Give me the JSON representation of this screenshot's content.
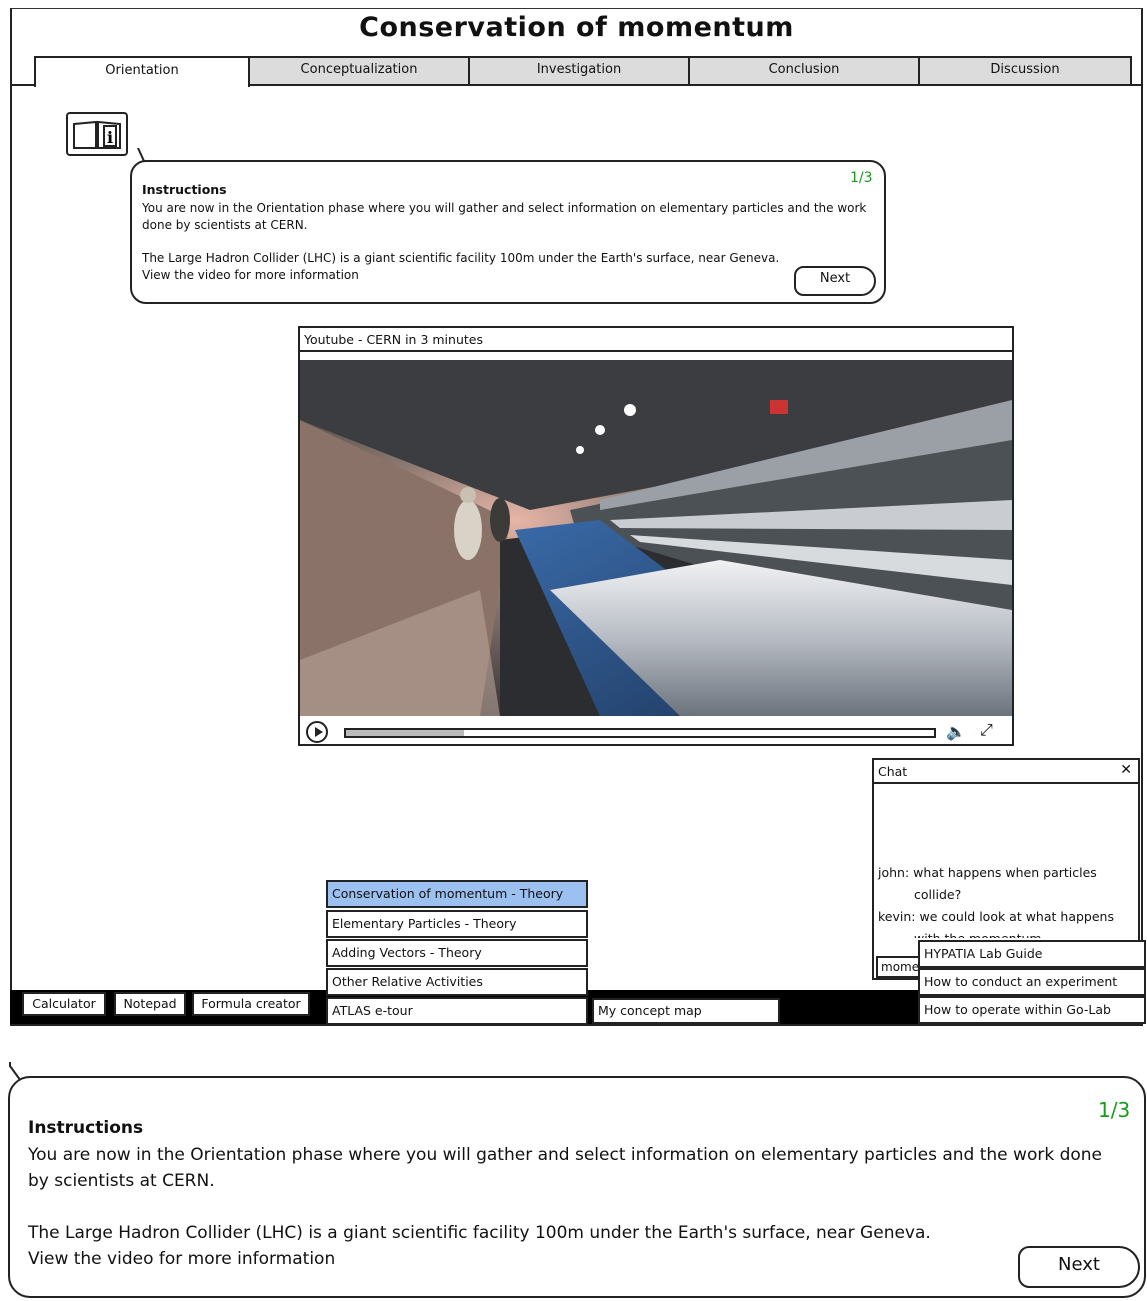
{
  "page": {
    "title": "Conservation of momentum"
  },
  "tabs": [
    {
      "label": "Orientation"
    },
    {
      "label": "Conceptualization"
    },
    {
      "label": "Investigation"
    },
    {
      "label": "Conclusion"
    },
    {
      "label": "Discussion"
    }
  ],
  "active_tab": "Orientation",
  "info_icon": "info-book-icon",
  "instructions": {
    "counter": "1/3",
    "heading": "Instructions",
    "para1": "You are now in the Orientation phase where you will gather and select information on elementary particles and the work done by scientists at CERN.",
    "para2_line1": "The Large Hadron Collider (LHC) is a giant scientific facility 100m under the Earth's surface, near Geneva.",
    "para2_line2": "View the video for more information",
    "next_label": "Next"
  },
  "video": {
    "title": "Youtube - CERN in 3 minutes",
    "progress": 0.2,
    "icons": [
      "play-icon",
      "volume-icon",
      "fullscreen-icon"
    ]
  },
  "chat": {
    "title": "Chat",
    "close_icon": "close-icon",
    "messages": [
      {
        "user": "john:",
        "line1": "what happens when particles",
        "line2": "collide?"
      },
      {
        "user": "kevin:",
        "line1": "we could look at what happens",
        "line2": "with the momentum"
      }
    ],
    "input_value": "mome"
  },
  "toolbar": {
    "tools": [
      "Calculator",
      "Notepad",
      "Formula creator"
    ],
    "resources": [
      "Conservation of momentum - Theory",
      "Elementary Particles - Theory",
      "Adding Vectors - Theory",
      "Other Relative Activities",
      "ATLAS e-tour"
    ],
    "selected_resource": "Conservation of momentum - Theory",
    "concept_map": "My concept map",
    "guides": [
      "HYPATIA Lab Guide",
      "How to conduct an experiment",
      "How to operate within Go-Lab"
    ]
  },
  "colors": {
    "counter": "#1a9a1a",
    "selected_menu": "#9cc0f0",
    "tab_inactive": "#dcdcdc"
  }
}
